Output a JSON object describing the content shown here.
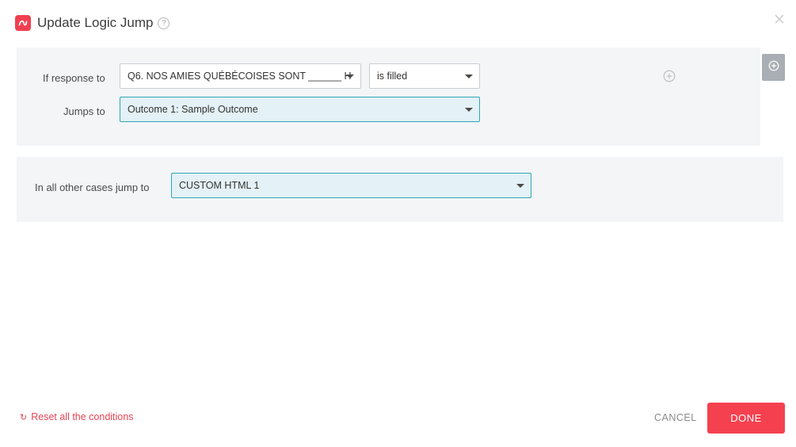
{
  "dialog": {
    "title": "Update Logic Jump",
    "help_icon": "question-circle-icon",
    "close_icon": "close-icon",
    "brand_color": "#f0404f"
  },
  "rule": {
    "if_label": "If response to",
    "question_value": "Q6. NOS AMIES QUÉBÉCOISES SONT ______ H",
    "condition_value": "is filled",
    "jumps_label": "Jumps to",
    "jump_value": "Outcome 1: Sample Outcome",
    "add_icon": "plus-circle-icon",
    "side_icon": "plus-circle-icon"
  },
  "other": {
    "label": "In all other cases jump to",
    "value": "CUSTOM HTML 1"
  },
  "footer": {
    "reset_label": "Reset all the conditions",
    "reset_icon": "refresh-icon",
    "cancel_label": "CANCEL",
    "done_label": "DONE"
  }
}
